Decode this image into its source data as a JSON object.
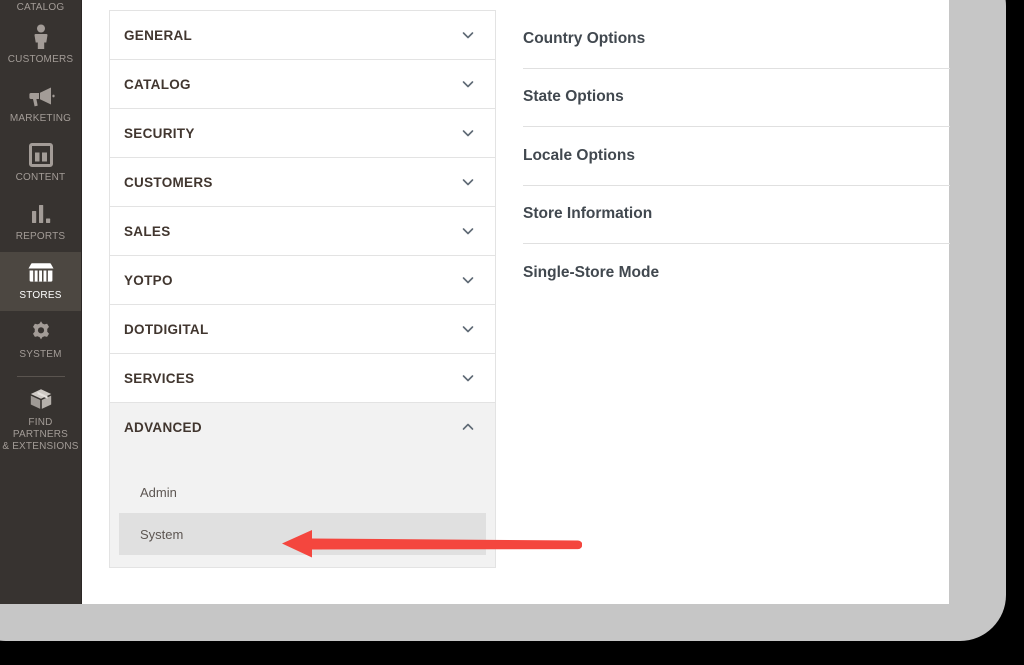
{
  "theme": {
    "accent_red": "#f4463e",
    "sidebar_bg": "#373330",
    "sidebar_active_bg": "#4c4741",
    "panel_bg": "#f2f2f2",
    "selected_bg": "#e0e0e0",
    "frame_gray": "#c6c6c6",
    "backdrop": "#000000"
  },
  "sidebar": {
    "clipped_top_label": "CATALOG",
    "items": [
      {
        "label": "CUSTOMERS",
        "icon": "person-icon",
        "active": false
      },
      {
        "label": "MARKETING",
        "icon": "megaphone-icon",
        "active": false
      },
      {
        "label": "CONTENT",
        "icon": "layout-icon",
        "active": false
      },
      {
        "label": "REPORTS",
        "icon": "bar-chart-icon",
        "active": false
      },
      {
        "label": "STORES",
        "icon": "storefront-icon",
        "active": true
      },
      {
        "label": "SYSTEM",
        "icon": "gear-icon",
        "active": false
      },
      {
        "label": "FIND PARTNERS\n& EXTENSIONS",
        "icon": "cube-box-icon",
        "active": false
      }
    ]
  },
  "accordion": {
    "sections": [
      {
        "label": "GENERAL",
        "expanded": false,
        "chevron": "chevron-down-icon"
      },
      {
        "label": "CATALOG",
        "expanded": false,
        "chevron": "chevron-down-icon"
      },
      {
        "label": "SECURITY",
        "expanded": false,
        "chevron": "chevron-down-icon"
      },
      {
        "label": "CUSTOMERS",
        "expanded": false,
        "chevron": "chevron-down-icon"
      },
      {
        "label": "SALES",
        "expanded": false,
        "chevron": "chevron-down-icon"
      },
      {
        "label": "YOTPO",
        "expanded": false,
        "chevron": "chevron-down-icon"
      },
      {
        "label": "DOTDIGITAL",
        "expanded": false,
        "chevron": "chevron-down-icon"
      },
      {
        "label": "SERVICES",
        "expanded": false,
        "chevron": "chevron-down-icon"
      },
      {
        "label": "ADVANCED",
        "expanded": true,
        "chevron": "chevron-up-icon"
      }
    ],
    "advanced_subitems": [
      {
        "label": "Admin",
        "selected": false
      },
      {
        "label": "System",
        "selected": true
      }
    ]
  },
  "section_list": {
    "rows": [
      {
        "label": "Country Options"
      },
      {
        "label": "State Options"
      },
      {
        "label": "Locale Options"
      },
      {
        "label": "Store Information"
      },
      {
        "label": "Single-Store Mode"
      }
    ]
  },
  "annotation": {
    "arrow": {
      "name": "red-left-arrow",
      "points_to": "System",
      "color": "#f4463e",
      "direction": "left"
    }
  }
}
